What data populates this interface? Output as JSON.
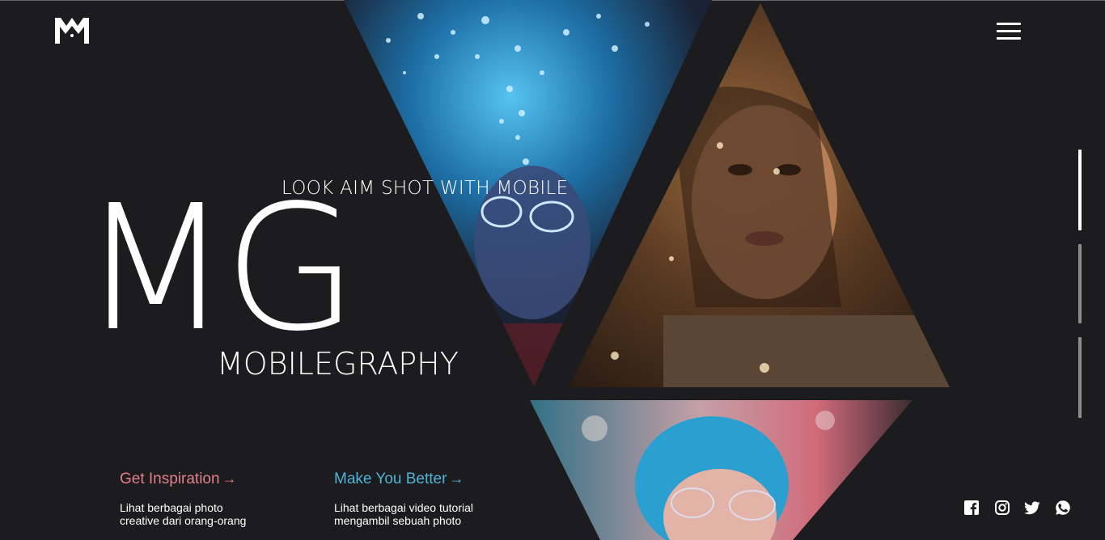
{
  "header": {
    "logo_name": "mg-logo",
    "menu_icon": "hamburger-menu-icon"
  },
  "hero": {
    "tagline": "LOOK AIM SHOT WITH MOBILE",
    "title": "MG",
    "subtitle": "MOBILEGRAPHY"
  },
  "features": [
    {
      "label": "Get Inspiration",
      "arrow": "→",
      "desc_line1": "Lihat berbagai photo",
      "desc_line2": "creative dari orang-orang",
      "color": "#e07f8b"
    },
    {
      "label": "Make You Better",
      "arrow": "→",
      "desc_line1": "Lihat berbagai video tutorial",
      "desc_line2": "mengambil sebuah photo",
      "color": "#4fb3d9"
    }
  ],
  "slider": {
    "count": 3,
    "active_index": 0
  },
  "social": [
    "facebook-icon",
    "instagram-icon",
    "twitter-icon",
    "whatsapp-icon"
  ],
  "colors": {
    "background": "#1c1c1e",
    "accent_pink": "#e07f8b",
    "accent_blue": "#4fb3d9"
  }
}
